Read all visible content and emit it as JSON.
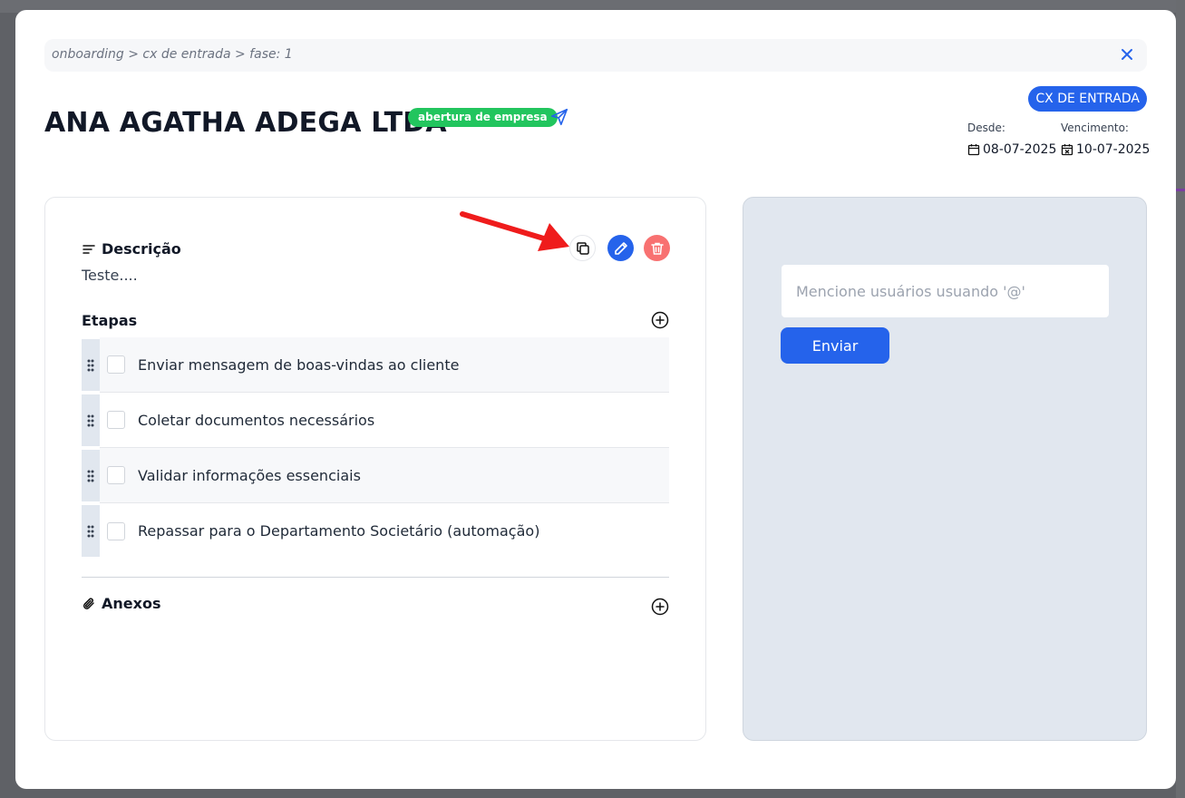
{
  "breadcrumb": "onboarding > cx de entrada > fase: 1",
  "header": {
    "title": "ANA AGATHA ADEGA LTDA",
    "tag": "abertura de empresa",
    "stage_badge": "CX DE ENTRADA",
    "since_label": "Desde:",
    "since_value": "08-07-2025",
    "due_label": "Vencimento:",
    "due_value": "10-07-2025"
  },
  "description": {
    "heading": "Descrição",
    "text": "Teste...."
  },
  "steps": {
    "heading": "Etapas",
    "items": [
      {
        "label": "Enviar mensagem de boas-vindas ao cliente"
      },
      {
        "label": "Coletar documentos necessários"
      },
      {
        "label": "Validar informações essenciais"
      },
      {
        "label": "Repassar para o Departamento Societário (automação)"
      }
    ]
  },
  "attachments": {
    "heading": "Anexos"
  },
  "comments": {
    "placeholder": "Mencione usuários usuando '@'",
    "send_label": "Enviar"
  },
  "colors": {
    "primary": "#2563eb",
    "tag_green": "#22c55e",
    "delete_red": "#f87171",
    "annotation_arrow": "#ef1c1c"
  }
}
